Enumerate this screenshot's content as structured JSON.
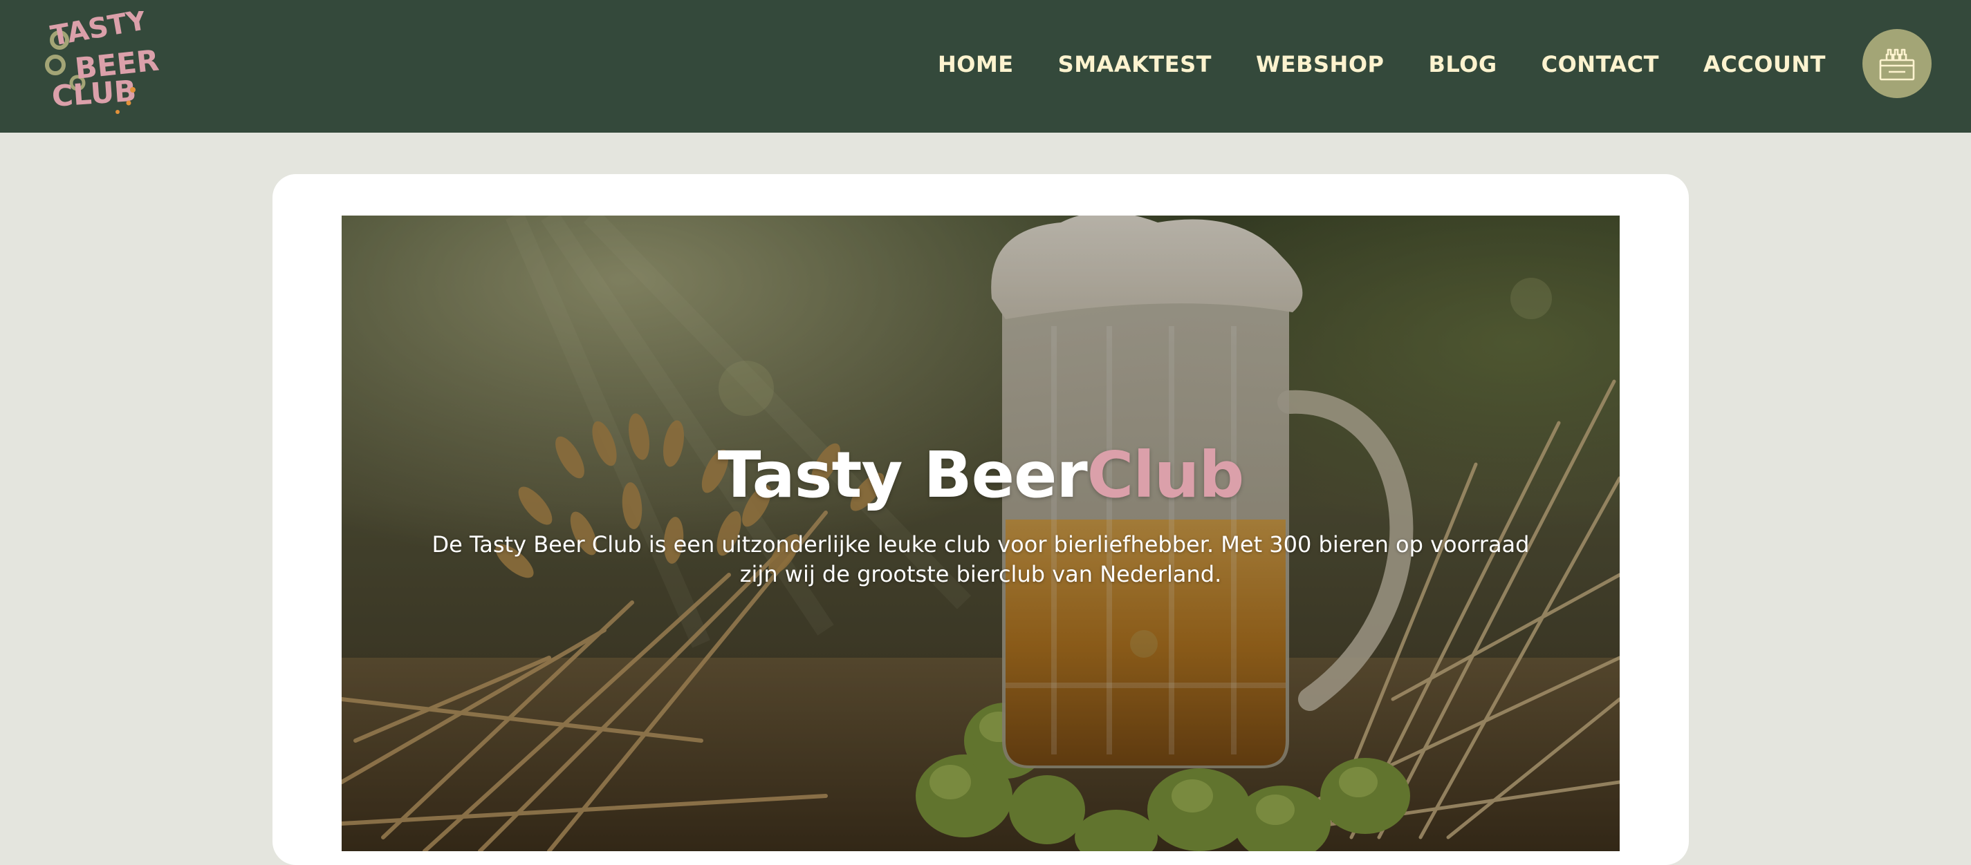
{
  "brand": {
    "logo_text": "TASTY BEER CLUB",
    "colors": {
      "header_bg": "#34493b",
      "page_bg": "#e4e5de",
      "nav_text": "#fdf3cf",
      "accent_pink": "#dba0aa",
      "cart_bg": "#a3a576"
    }
  },
  "nav": {
    "items": [
      {
        "label": "HOME"
      },
      {
        "label": "SMAAKTEST"
      },
      {
        "label": "WEBSHOP"
      },
      {
        "label": "BLOG"
      },
      {
        "label": "CONTACT"
      },
      {
        "label": "ACCOUNT"
      }
    ],
    "cart_icon": "beer-crate-icon"
  },
  "hero": {
    "title_main": "Tasty Beer",
    "title_accent": "Club",
    "text": "De Tasty Beer Club is een uitzonderlijke leuke club voor bierliefhebber. Met 300 bieren op voorraad zijn wij de grootste bierclub van Nederland."
  }
}
